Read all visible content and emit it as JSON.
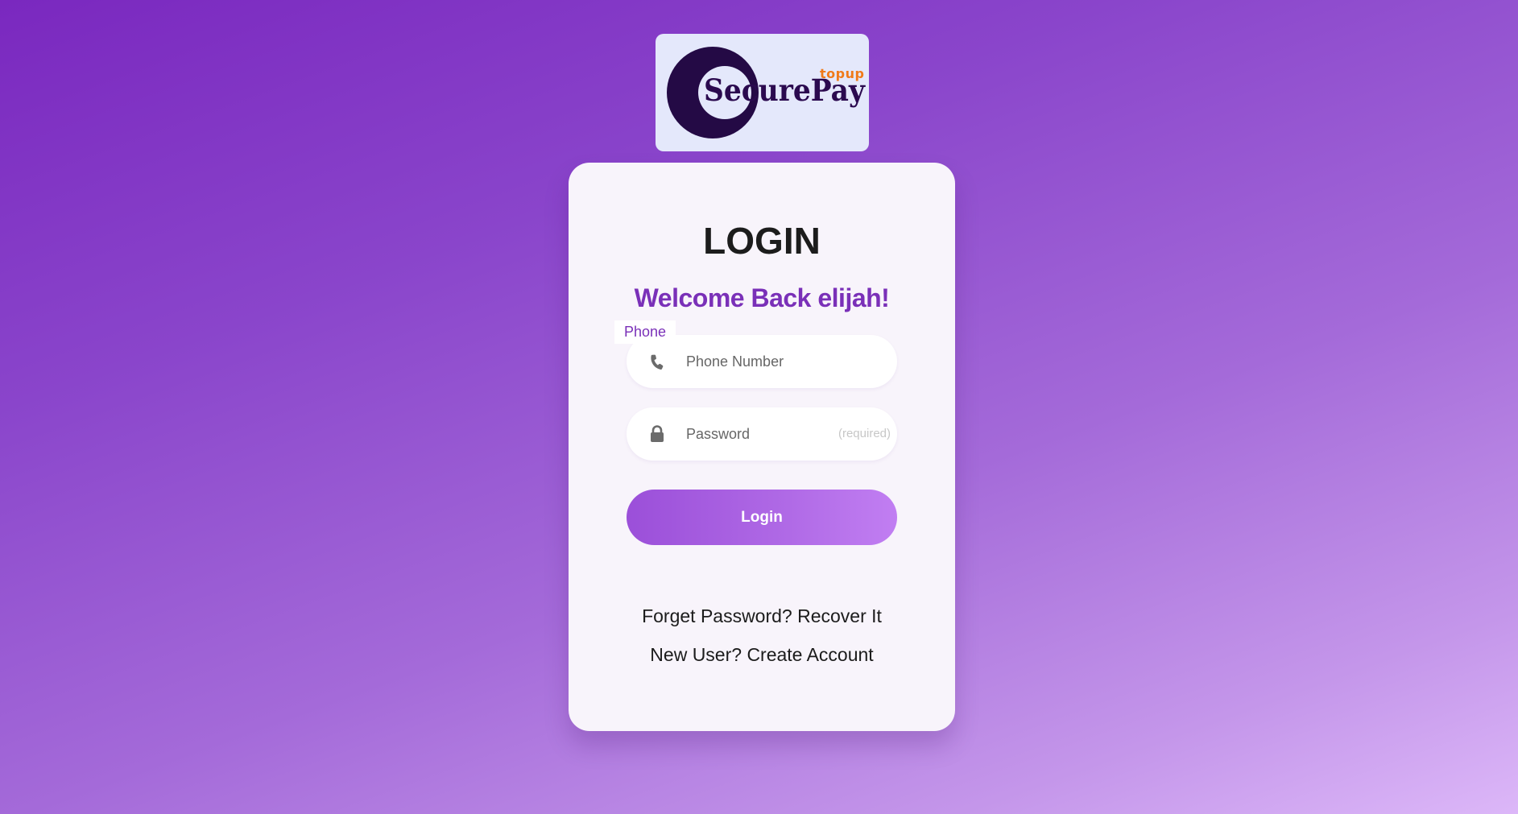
{
  "brand": {
    "name": "SecurePay",
    "tag": "topup",
    "logo_colors": {
      "circle": "#240a45",
      "tag": "#f07a19",
      "background": "#e4e8fb"
    }
  },
  "login": {
    "title": "LOGIN",
    "welcome": "Welcome Back elijah!",
    "phone_label": "Phone",
    "phone_placeholder": "Phone Number",
    "phone_icon": "phone-icon",
    "password_placeholder": "Password",
    "password_hint": "(required)",
    "password_icon": "lock-icon",
    "submit_label": "Login"
  },
  "links": {
    "recover": "Forget Password? Recover It",
    "create": "New User? Create Account"
  },
  "colors": {
    "accent": "#7a30b8",
    "button_start": "#9b4fd9",
    "button_end": "#c17ef2"
  }
}
